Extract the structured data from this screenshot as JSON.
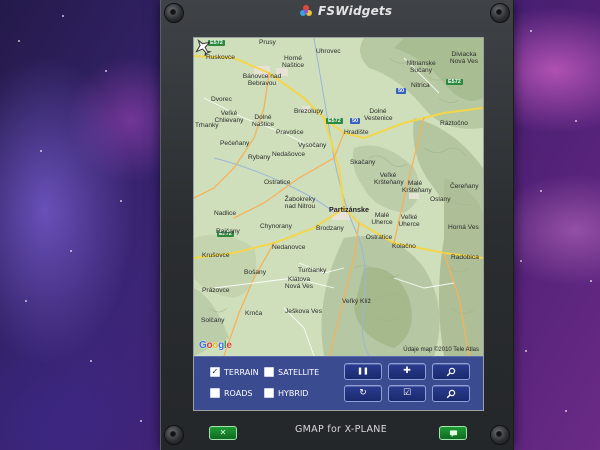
{
  "brand": {
    "name": "FSWidgets",
    "icon": "fswidgets-logo-icon"
  },
  "footer": {
    "title": "GMAP for X-PLANE",
    "left_button_icon": "close-icon",
    "right_button_icon": "chat-icon"
  },
  "map": {
    "attribution": "Údaje map ©2010 Tele Atlas",
    "logo": "Google",
    "aircraft_icon": "aircraft-icon",
    "places": [
      "Ruskovce",
      "Prusy",
      "Uhrovec",
      "Horné Naštice",
      "Bánovce nad Bebravou",
      "Dvorec",
      "Veľké Chlievany",
      "Dolné Naštice",
      "Brezolupy",
      "Pravotice",
      "Vysočany",
      "Hradište",
      "Ostratice",
      "Rybany",
      "Nedašovce",
      "Skačany",
      "Pečeňany",
      "Trhanky",
      "Žabokreky nad Nitrou",
      "Partizánske",
      "Nadlice",
      "Chynorany",
      "Brodzany",
      "Malé Uherce",
      "Veľké Uherce",
      "Oslany",
      "Ostratice",
      "Kolačno",
      "Krušovce",
      "Nedanovce",
      "Turčianky",
      "Klátova Nová Ves",
      "Bošany",
      "Veľký Klíž",
      "Prázovce",
      "Krnča",
      "Ješkova Ves",
      "Solčany",
      "Malé Kršteňany",
      "Veľké Kršteňany",
      "Ráztočno",
      "Nitrica",
      "Dolné Vestenice",
      "Nitrianske Sučany",
      "Diviacka Nová Ves",
      "Čereňany",
      "Horná Ves",
      "Radobica",
      "Rajčany"
    ],
    "road_labels": [
      "E572",
      "E572",
      "E572",
      "E572",
      "50",
      "50"
    ]
  },
  "controls": {
    "options": [
      {
        "label": "TERRAIN",
        "checked": true
      },
      {
        "label": "SATELLITE",
        "checked": false
      },
      {
        "label": "ROADS",
        "checked": false
      },
      {
        "label": "HYBRID",
        "checked": false
      }
    ],
    "buttons": [
      {
        "icon": "pause-icon",
        "glyph": "❚❚"
      },
      {
        "icon": "crosshair-icon",
        "glyph": "✚"
      },
      {
        "icon": "zoom-in-icon"
      },
      {
        "icon": "refresh-icon",
        "glyph": "↻"
      },
      {
        "icon": "checkbox-icon",
        "glyph": "☑"
      },
      {
        "icon": "zoom-out-icon"
      }
    ]
  },
  "colors": {
    "panel_blue": "#3b4b90",
    "button_blue": "#1a2a6e",
    "led_green": "#1f9a35",
    "map_terrain": "#c9dcb3",
    "road_yellow": "#f3d64a"
  }
}
